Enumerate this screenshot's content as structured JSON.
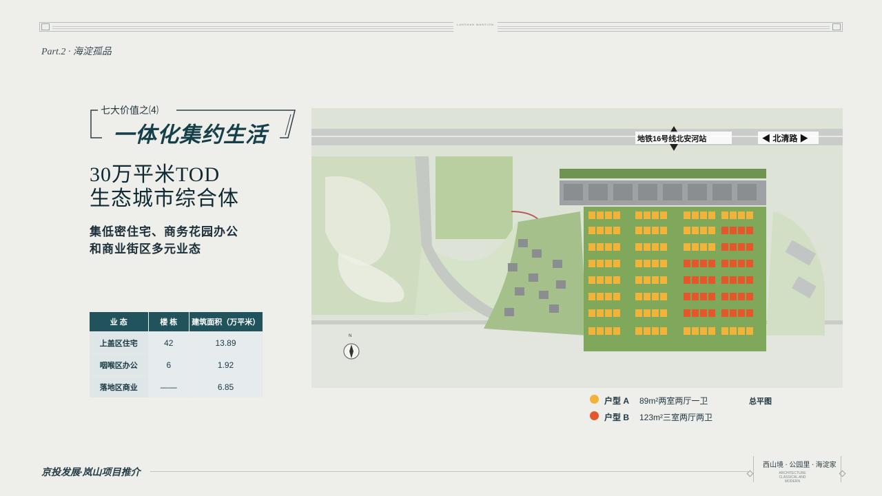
{
  "header": {
    "ornament_text": "LANSHAN MANSION",
    "part_label": "Part.2 · 海淀孤品"
  },
  "title_block": {
    "subtitle": "七大价值之⑷",
    "title": "一体化集约生活",
    "headline_lines": [
      "30万平米TOD",
      "生态城市综合体"
    ],
    "description_lines": [
      "集低密住宅、商务花园办公",
      "和商业街区多元业态"
    ]
  },
  "table": {
    "headers": [
      "业 态",
      "楼 栋",
      "建筑面积（万平米）"
    ],
    "rows": [
      {
        "type": "上盖区住宅",
        "buildings": "42",
        "area": "13.89"
      },
      {
        "type": "咽喉区办公",
        "buildings": "6",
        "area": "1.92"
      },
      {
        "type": "落地区商业",
        "buildings": "——",
        "area": "6.85"
      }
    ]
  },
  "map": {
    "station_label": "地铁16号线北安河站",
    "road_label": "◀ 北清路 ▶",
    "compass_label": "N",
    "colors": {
      "type_a": "#f2b33a",
      "type_b": "#e5572a",
      "grass": "#7fa85a",
      "building": "#8a8e91"
    }
  },
  "legend": {
    "items": [
      {
        "label": "户型 A",
        "desc": "89m²两室两厅一卫",
        "color": "#f2b33a"
      },
      {
        "label": "户型 B",
        "desc": "123m²三室两厅两卫",
        "color": "#e5572a"
      }
    ],
    "plan_label": "总平图"
  },
  "footer": {
    "left": "京投发展·岚山项目推介",
    "right": "西山境 · 公园里 · 海淀家",
    "right_small": "ARCHITECTURE CLASSICAL AND MODERN"
  }
}
